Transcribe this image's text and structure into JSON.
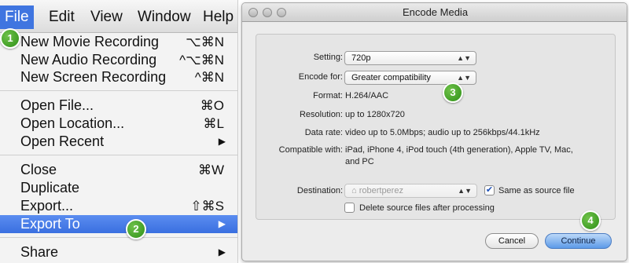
{
  "menubar": {
    "items": [
      {
        "label": "File"
      },
      {
        "label": "Edit"
      },
      {
        "label": "View"
      },
      {
        "label": "Window"
      },
      {
        "label": "Help"
      }
    ]
  },
  "file_menu": {
    "items": [
      {
        "label": "New Movie Recording",
        "shortcut": "⌥⌘N"
      },
      {
        "label": "New Audio Recording",
        "shortcut": "^⌥⌘N"
      },
      {
        "label": "New Screen Recording",
        "shortcut": "^⌘N"
      },
      {
        "label": "Open File...",
        "shortcut": "⌘O"
      },
      {
        "label": "Open Location...",
        "shortcut": "⌘L"
      },
      {
        "label": "Open Recent",
        "arrow": "▶"
      },
      {
        "label": "Close",
        "shortcut": "⌘W"
      },
      {
        "label": "Duplicate",
        "shortcut": ""
      },
      {
        "label": "Export...",
        "shortcut": "⇧⌘S"
      },
      {
        "label": "Export To",
        "arrow": "▶"
      },
      {
        "label": "Share",
        "arrow": "▶"
      }
    ]
  },
  "badges": [
    "1",
    "2",
    "3",
    "4"
  ],
  "dialog": {
    "title": "Encode Media",
    "setting_label": "Setting:",
    "setting_value": "720p",
    "encode_label": "Encode for:",
    "encode_value": "Greater compatibility",
    "format_label": "Format:",
    "format_value": "H.264/AAC",
    "resolution_label": "Resolution:",
    "resolution_value": "up to 1280x720",
    "datarate_label": "Data rate:",
    "datarate_value": "video up to 5.0Mbps; audio up to 256kbps/44.1kHz",
    "compatible_label": "Compatible with:",
    "compatible_value_line1": "iPad, iPhone 4, iPod touch (4th generation), Apple TV, Mac,",
    "compatible_value_line2": "and PC",
    "destination_label": "Destination:",
    "destination_value": "robertperez",
    "same_as_source_label": "Same as source file",
    "same_as_source_checked": true,
    "delete_source_label": "Delete source files after processing",
    "delete_source_checked": false,
    "cancel_label": "Cancel",
    "continue_label": "Continue"
  },
  "colors": {
    "menu_highlight": "#3f75e0",
    "badge_green": "#3a9a1f",
    "primary_button": "#5c9ae8"
  }
}
